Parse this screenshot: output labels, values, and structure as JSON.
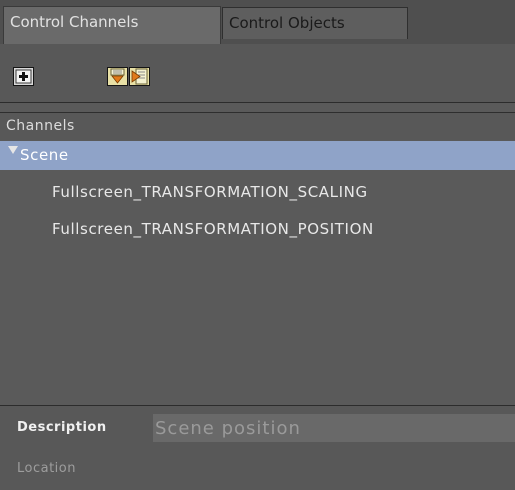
{
  "tabs": [
    {
      "label": "Control Channels",
      "active": true
    },
    {
      "label": "Control Objects",
      "active": false
    }
  ],
  "toolbar": {
    "add_icon": "add-channel-icon",
    "move_down_icon": "move-down-icon",
    "move_right_icon": "move-right-icon"
  },
  "channels": {
    "header": "Channels",
    "root": {
      "label": "Scene",
      "expanded": true,
      "selected": true
    },
    "items": [
      {
        "label": "Fullscreen_TRANSFORMATION_SCALING"
      },
      {
        "label": "Fullscreen_TRANSFORMATION_POSITION"
      }
    ]
  },
  "properties": {
    "description_label": "Description",
    "description_value": "Scene position",
    "location_label": "Location"
  },
  "colors": {
    "selection": "#8fa3c8",
    "panel": "#5a5a5a"
  }
}
